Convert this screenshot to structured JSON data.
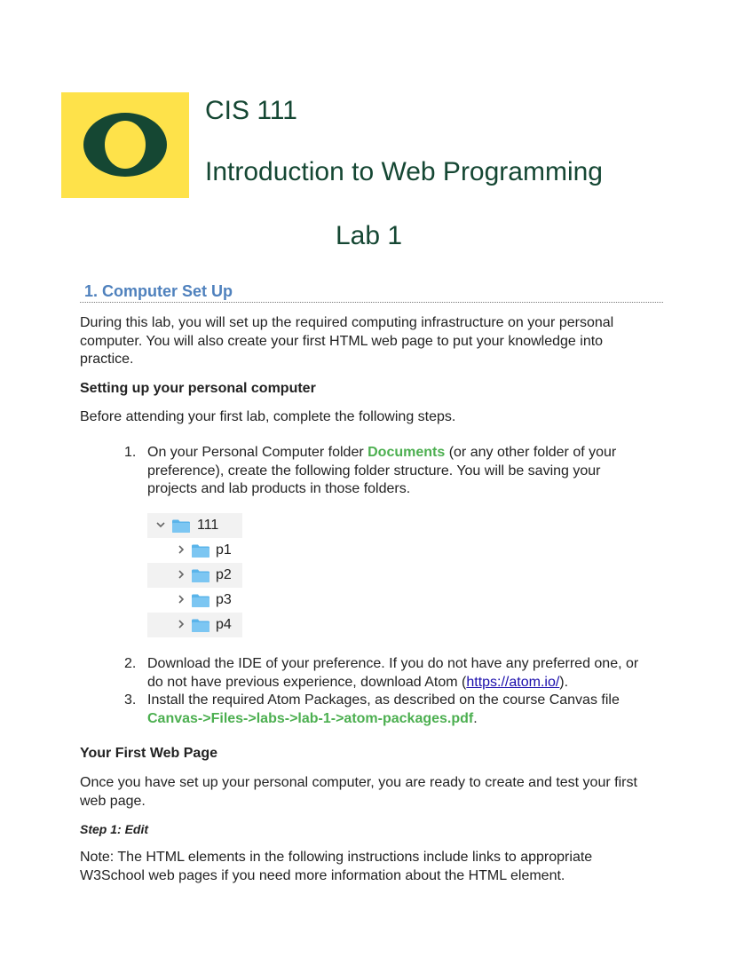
{
  "header": {
    "course_code": "CIS 111",
    "course_name": "Introduction to Web Programming",
    "lab_title": "Lab 1",
    "logo_icon": "university-o-logo",
    "colors": {
      "logo_bg": "#FEE24A",
      "logo_green": "#154733",
      "title_green": "#154733"
    }
  },
  "section1": {
    "heading": "1.  Computer Set Up",
    "intro": "During this lab, you will set up the required computing infrastructure on your personal computer. You will also create your first HTML web page to put your knowledge into practice.",
    "setup_heading": "Setting up your personal computer",
    "setup_intro": "Before attending your first lab, complete the following steps.",
    "steps": [
      {
        "num": "1.",
        "before": "On your Personal Computer folder ",
        "highlight": "Documents",
        "after": " (or any other folder of your preference), create the following folder structure. You will be saving your projects and lab products in those folders."
      },
      {
        "num": "2.",
        "before": "Download the IDE of your preference. If you do not have any preferred one, or do not have previous experience, download Atom (",
        "link": "https://atom.io/",
        "after": ")."
      },
      {
        "num": "3.",
        "before": "Install the required Atom Packages, as described on the course Canvas file ",
        "highlight": "Canvas->Files->labs->lab-1->atom-packages.pdf",
        "after": "."
      }
    ],
    "folder_tree": [
      {
        "name": "111",
        "expanded": true,
        "level": 0
      },
      {
        "name": "p1",
        "expanded": false,
        "level": 1
      },
      {
        "name": "p2",
        "expanded": false,
        "level": 1
      },
      {
        "name": "p3",
        "expanded": false,
        "level": 1
      },
      {
        "name": "p4",
        "expanded": false,
        "level": 1
      }
    ],
    "first_page_heading": "Your First Web Page",
    "first_page_intro": "Once you have set up your personal computer, you are ready to create and test your first web page.",
    "step1_heading": "Step 1: Edit",
    "note": "Note: The HTML elements in the following instructions include links to appropriate W3School web pages if you need more information about the HTML element.",
    "colors": {
      "heading_blue": "#4F81BD",
      "highlight_green": "#4CAF50",
      "link_blue": "#1a0dab",
      "folder_blue": "#5AB4EA"
    }
  }
}
